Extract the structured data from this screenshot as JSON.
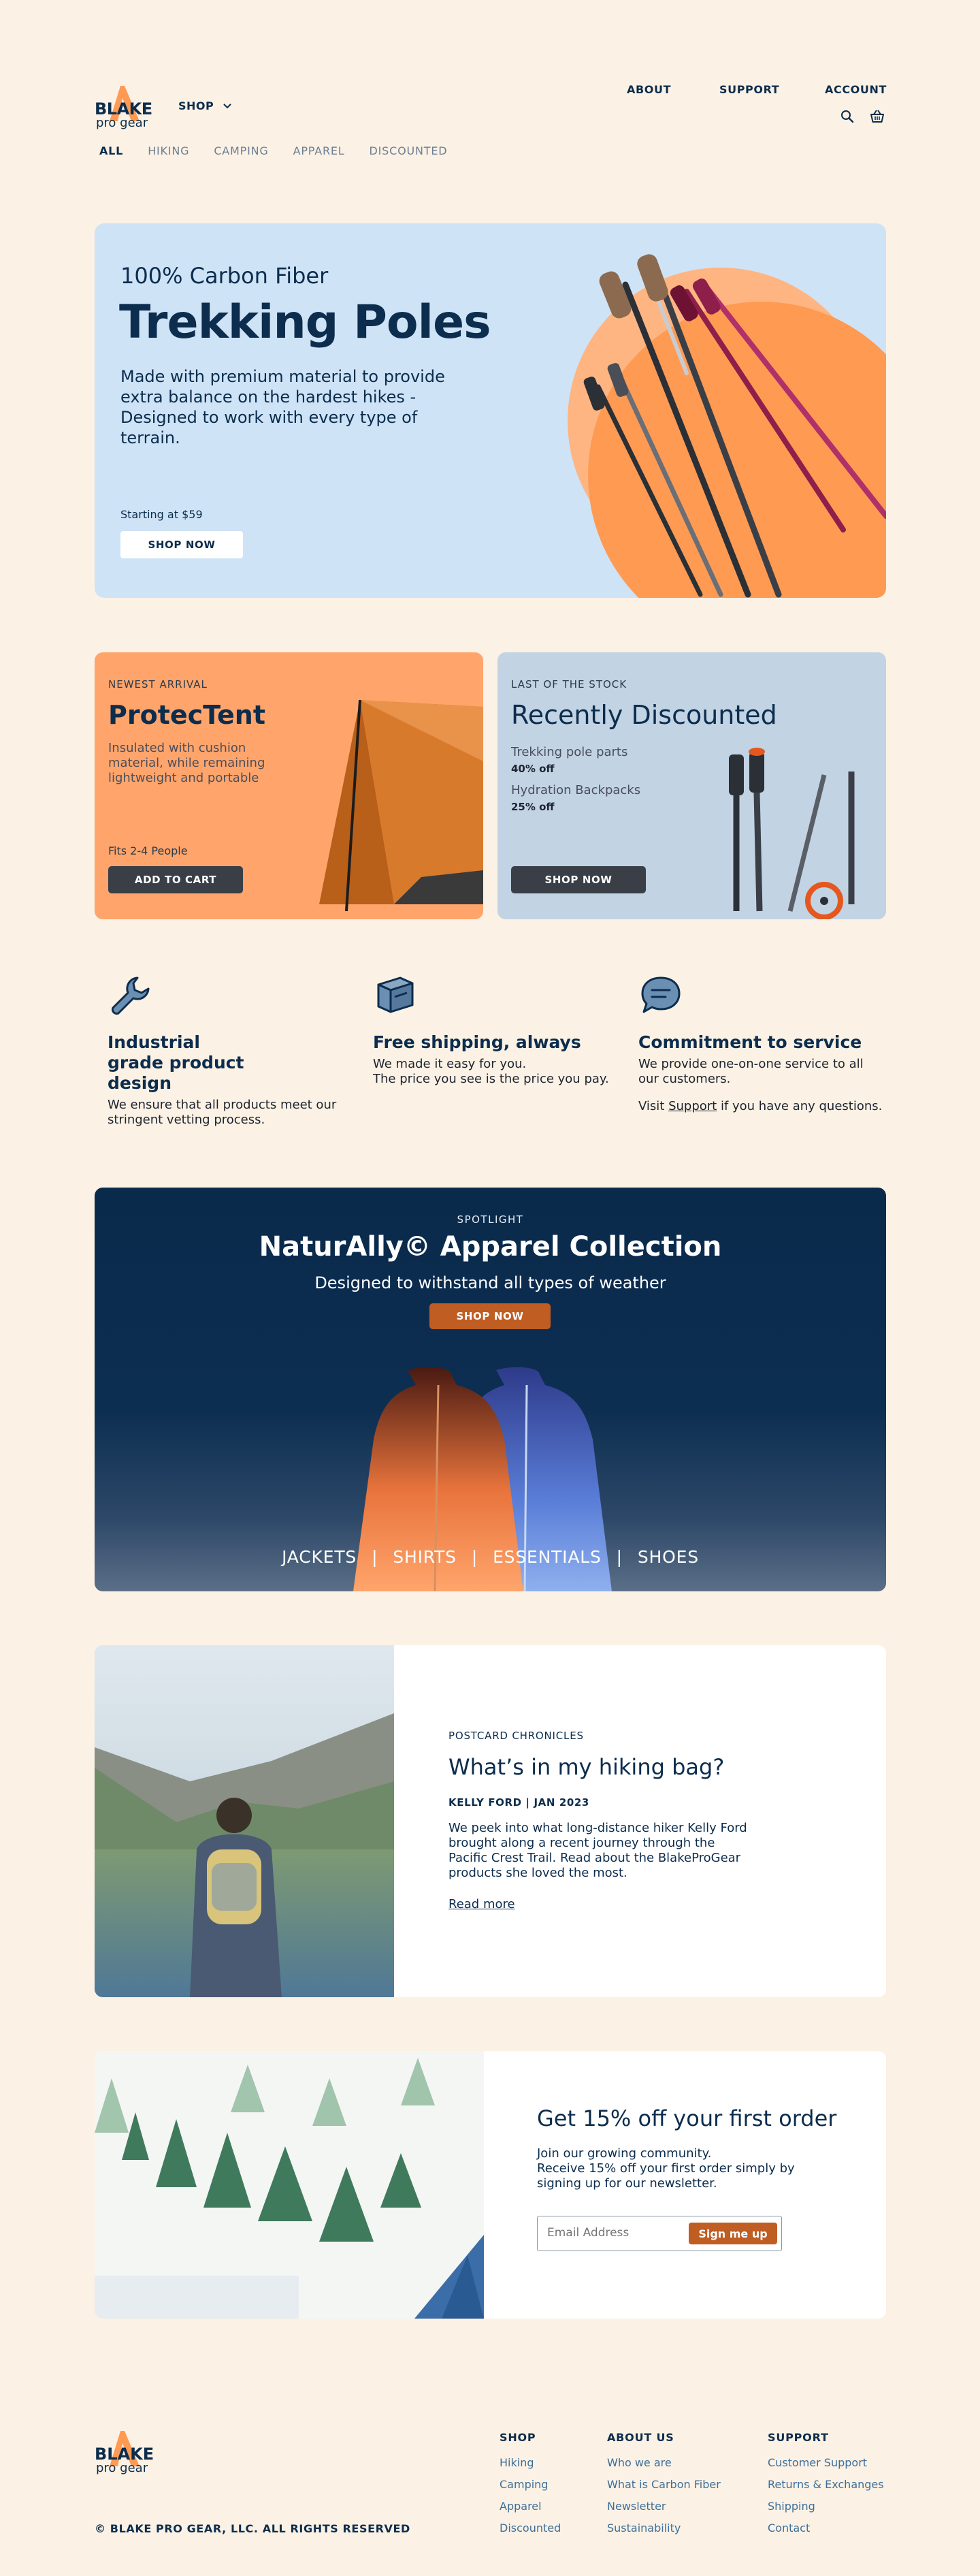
{
  "brand": {
    "name": "BLAKE",
    "sub": "pro gear",
    "accent": "#ff9a52",
    "navy": "#0c2d4d"
  },
  "header": {
    "shop_label": "SHOP",
    "nav": [
      "ABOUT",
      "SUPPORT",
      "ACCOUNT"
    ],
    "icons": [
      "search-icon",
      "basket-icon"
    ],
    "filters": [
      "ALL",
      "HIKING",
      "CAMPING",
      "APPAREL",
      "DISCOUNTED"
    ]
  },
  "hero": {
    "kicker": "100% Carbon Fiber",
    "title": "Trekking Poles",
    "description": "Made with premium material to provide extra balance on the hardest hikes - Designed to work with every type of terrain.",
    "price": "Starting at $59",
    "cta": "SHOP NOW"
  },
  "card_new": {
    "kicker": "NEWEST ARRIVAL",
    "title": "ProtecTent",
    "description": "Insulated with cushion material, while remaining lightweight and portable",
    "note": "Fits 2-4 People",
    "cta": "ADD TO CART"
  },
  "card_discount": {
    "kicker": "LAST OF THE STOCK",
    "title": "Recently Discounted",
    "deals": [
      {
        "name": "Trekking pole parts",
        "off": "40% off"
      },
      {
        "name": "Hydration Backpacks",
        "off": "25% off"
      }
    ],
    "cta": "SHOP NOW"
  },
  "features": [
    {
      "icon": "wrench-icon",
      "title": "Industrial grade product design",
      "body": "We ensure that all products meet our stringent vetting process."
    },
    {
      "icon": "box-icon",
      "title": "Free shipping, always",
      "body": "We made it easy for you.",
      "body2": "The price you see is the price you pay."
    },
    {
      "icon": "chat-icon",
      "title": "Commitment to service",
      "body": "We provide one-on-one service to all our customers.",
      "pre_link": "Visit ",
      "link": "Support",
      "post_link": " if you have any questions."
    }
  ],
  "spotlight": {
    "kicker": "SPOTLIGHT",
    "title": "NaturAlly© Apparel Collection",
    "subtitle": "Designed to withstand all types of weather",
    "cta": "SHOP NOW",
    "categories": [
      "JACKETS",
      "SHIRTS",
      "ESSENTIALS",
      "SHOES"
    ],
    "separator": "|"
  },
  "article": {
    "kicker": "POSTCARD CHRONICLES",
    "title": "What’s in my hiking bag?",
    "byline": "KELLY FORD | JAN 2023",
    "body": "We peek into what long-distance hiker Kelly Ford brought along a recent journey through the Pacific Crest Trail. Read about the BlakeProGear products she loved the most.",
    "link": "Read more"
  },
  "newsletter": {
    "title": "Get 15% off your first order",
    "line1": "Join our growing community.",
    "line2": "Receive 15% off your first order simply by signing up for our newsletter.",
    "placeholder": "Email Address",
    "cta": "Sign me up"
  },
  "footer": {
    "copyright": "©   BLAKE PRO GEAR, LLC. ALL RIGHTS RESERVED",
    "columns": [
      {
        "heading": "SHOP",
        "links": [
          "Hiking",
          "Camping",
          "Apparel",
          "Discounted"
        ]
      },
      {
        "heading": "ABOUT US",
        "links": [
          "Who we are",
          "What is Carbon Fiber",
          "Newsletter",
          "Sustainability"
        ]
      },
      {
        "heading": "SUPPORT",
        "links": [
          "Customer Support",
          "Returns & Exchanges",
          "Shipping",
          "Contact"
        ]
      }
    ]
  }
}
